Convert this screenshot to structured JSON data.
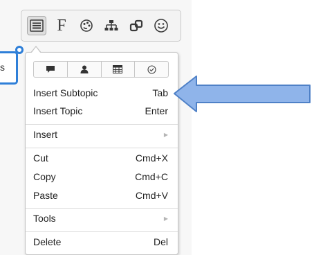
{
  "toolbar": {
    "buttons": [
      {
        "id": "menu",
        "icon": "hamburger-menu-icon",
        "active": true
      },
      {
        "id": "font",
        "icon": "font-icon",
        "glyph": "F",
        "active": false
      },
      {
        "id": "style",
        "icon": "palette-icon",
        "active": false
      },
      {
        "id": "structure",
        "icon": "structure-icon",
        "active": false
      },
      {
        "id": "relation",
        "icon": "relationship-icon",
        "active": false
      },
      {
        "id": "marker",
        "icon": "smiley-icon",
        "active": false
      }
    ]
  },
  "topic": {
    "edge_text": "s"
  },
  "context_menu": {
    "quick_actions": [
      {
        "icon": "comment-icon"
      },
      {
        "icon": "person-icon"
      },
      {
        "icon": "table-icon"
      },
      {
        "icon": "check-circle-icon"
      }
    ],
    "items": [
      {
        "label": "Insert Subtopic",
        "shortcut": "Tab"
      },
      {
        "label": "Insert Topic",
        "shortcut": "Enter"
      },
      {
        "label": "Insert",
        "shortcut": "",
        "submenu": true
      },
      {
        "label": "Cut",
        "shortcut": "Cmd+X"
      },
      {
        "label": "Copy",
        "shortcut": "Cmd+C"
      },
      {
        "label": "Paste",
        "shortcut": "Cmd+V"
      },
      {
        "label": "Tools",
        "shortcut": "",
        "submenu": true
      },
      {
        "label": "Delete",
        "shortcut": "Del"
      }
    ]
  },
  "colors": {
    "accent_blue": "#2e7fd8",
    "arrow_fill": "#8fb4ea",
    "arrow_stroke": "#4f81c7"
  }
}
